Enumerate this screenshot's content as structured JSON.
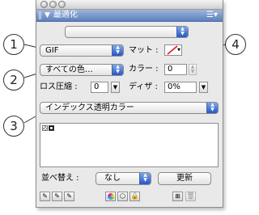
{
  "window": {
    "title": "最適化",
    "panel_menu_icon": "panel-menu-icon",
    "window_buttons": [
      "close",
      "minimize",
      "zoom"
    ]
  },
  "settings_popup": {
    "value": ""
  },
  "format_popup": {
    "value": "GIF"
  },
  "matte": {
    "label": "マット :"
  },
  "colors_reduction_popup": {
    "value": "すべての色…"
  },
  "colors": {
    "label": "カラー :",
    "value": "0"
  },
  "lossy": {
    "label": "ロス圧縮 :",
    "value": "0"
  },
  "dither": {
    "label": "ディザ :",
    "value": "0%"
  },
  "transparency_popup": {
    "value": "インデックス透明カラー"
  },
  "sort": {
    "label": "並べ替え :",
    "value": "なし"
  },
  "update_button": {
    "label": "更新"
  },
  "callouts": [
    "1",
    "2",
    "3",
    "4"
  ],
  "colors_accent": {
    "title_bar": "#5e7fba",
    "popup_arrow": "#2457c6",
    "matte_slash": "#d11a1a"
  }
}
